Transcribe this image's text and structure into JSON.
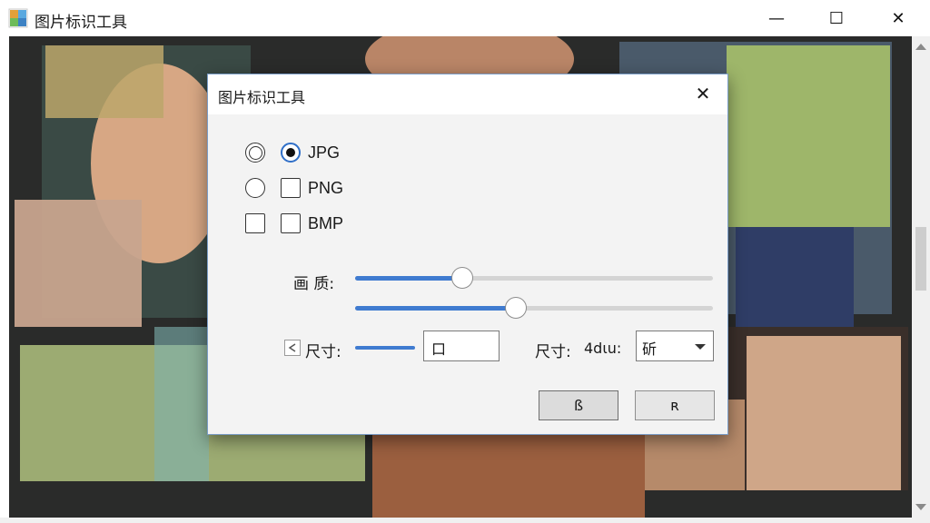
{
  "window": {
    "title": "图片标识工具",
    "controls": {
      "minimize": "—",
      "maximize": "☐",
      "close": "✕"
    }
  },
  "dialog": {
    "title": "图片标识工具",
    "close": "✕",
    "formats": [
      {
        "label": "JPG",
        "radio_state": "double",
        "box_state": "selected"
      },
      {
        "label": "PNG",
        "radio_state": "empty",
        "box_state": "unchecked"
      },
      {
        "label": "BMP",
        "radio_state": "checkbox",
        "box_state": "unchecked"
      }
    ],
    "quality": {
      "label": "画  质:",
      "slider1_value": 0.3,
      "slider2_value": 0.45
    },
    "size": {
      "label": "尺寸:",
      "input_value": "口",
      "label2": "尺寸:",
      "unit_text": "4dιu:",
      "select_value": "斫"
    },
    "buttons": {
      "ok": "ß",
      "cancel": "ʀ"
    }
  },
  "colors": {
    "accent": "#3f7bd0",
    "dialog_bg": "#f3f3f3",
    "backdrop": "#2a2b2a",
    "overlay_green": "#a7c06a"
  }
}
